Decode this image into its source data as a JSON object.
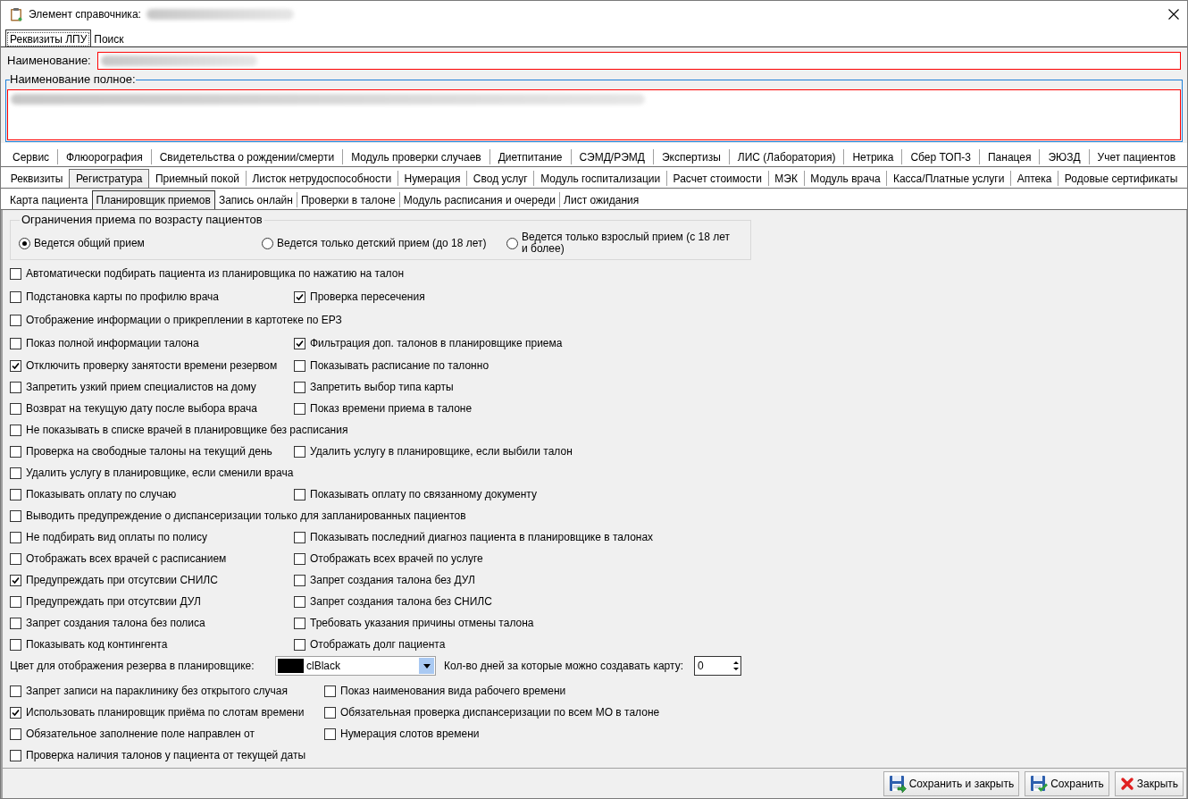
{
  "window": {
    "title": "Элемент справочника:"
  },
  "top_tabs": [
    {
      "label": "Реквизиты ЛПУ",
      "selected": true
    },
    {
      "label": "Поиск",
      "selected": false
    }
  ],
  "name_field": {
    "label": "Наименование:"
  },
  "full_name_group": {
    "label": "Наименование полное:"
  },
  "tab_rows": [
    {
      "tabs": [
        {
          "label": "Сервис",
          "selected": false
        },
        {
          "label": "Флюорография",
          "selected": false
        },
        {
          "label": "Свидетельства о рождении/смерти",
          "selected": false
        },
        {
          "label": "Модуль проверки случаев",
          "selected": false
        },
        {
          "label": "Диетпитание",
          "selected": false
        },
        {
          "label": "СЭМД/РЭМД",
          "selected": false
        },
        {
          "label": "Экспертизы",
          "selected": false
        },
        {
          "label": "ЛИС (Лаборатория)",
          "selected": false
        },
        {
          "label": "Нетрика",
          "selected": false
        },
        {
          "label": "Сбер ТОП-3",
          "selected": false
        },
        {
          "label": "Панацея",
          "selected": false
        },
        {
          "label": "ЭЮЗД",
          "selected": false
        },
        {
          "label": "Учет пациентов",
          "selected": false
        }
      ]
    },
    {
      "tabs": [
        {
          "label": "Реквизиты",
          "selected": false
        },
        {
          "label": "Регистратура",
          "selected": true
        },
        {
          "label": "Приемный покой",
          "selected": false
        },
        {
          "label": "Листок нетрудоспособности",
          "selected": false
        },
        {
          "label": "Нумерация",
          "selected": false
        },
        {
          "label": "Свод услуг",
          "selected": false
        },
        {
          "label": "Модуль госпитализации",
          "selected": false
        },
        {
          "label": "Расчет стоимости",
          "selected": false
        },
        {
          "label": "МЭК",
          "selected": false
        },
        {
          "label": "Модуль врача",
          "selected": false
        },
        {
          "label": "Касса/Платные услуги",
          "selected": false
        },
        {
          "label": "Аптека",
          "selected": false
        },
        {
          "label": "Родовые сертификаты",
          "selected": false
        }
      ]
    }
  ],
  "sub_tabs": [
    {
      "label": "Карта пациента",
      "selected": false
    },
    {
      "label": "Планировщик приемов",
      "selected": true
    },
    {
      "label": "Запись онлайн",
      "selected": false
    },
    {
      "label": "Проверки в талоне",
      "selected": false
    },
    {
      "label": "Модуль расписания и очереди",
      "selected": false
    },
    {
      "label": "Лист ожидания",
      "selected": false
    }
  ],
  "age_limit": {
    "title": "Ограничения приема по возрасту пациентов",
    "options": [
      {
        "label": "Ведется общий прием",
        "selected": true
      },
      {
        "label": "Ведется только детский прием (до 18 лет)",
        "selected": false
      },
      {
        "label": "Ведется только взрослый прием (с 18 лет и более)",
        "selected": false
      }
    ]
  },
  "options": [
    {
      "items": [
        {
          "label": "Автоматически подбирать пациента из планировщика по нажатию на талон",
          "checked": false
        }
      ]
    },
    {
      "items": [
        {
          "label": "Подстановка карты по профилю врача",
          "checked": false
        },
        {
          "label": "Проверка пересечения",
          "checked": true
        }
      ]
    },
    {
      "items": [
        {
          "label": "Отображение информации о прикреплении в картотеке по ЕРЗ",
          "checked": false
        }
      ]
    },
    {
      "items": [
        {
          "label": "Показ полной информации талона",
          "checked": false
        },
        {
          "label": "Фильтрация доп. талонов в планировщике приема",
          "checked": true
        }
      ]
    },
    {
      "items": [
        {
          "label": "Отключить проверку занятости времени резервом",
          "checked": true
        },
        {
          "label": "Показывать расписание по талонно",
          "checked": false
        }
      ]
    },
    {
      "items": [
        {
          "label": "Запретить узкий прием специалистов на дому",
          "checked": false
        },
        {
          "label": "Запретить выбор типа карты",
          "checked": false
        }
      ]
    },
    {
      "items": [
        {
          "label": "Возврат на текущую дату после выбора врача",
          "checked": false
        },
        {
          "label": "Показ времени приема в талоне",
          "checked": false
        }
      ]
    },
    {
      "items": [
        {
          "label": "Не показывать в списке врачей в планировщике без расписания",
          "checked": false
        }
      ]
    },
    {
      "items": [
        {
          "label": "Проверка на свободные талоны на текущий день",
          "checked": false
        },
        {
          "label": "Удалить услугу в планировщике, если выбили талон",
          "checked": false
        }
      ]
    },
    {
      "items": [
        {
          "label": "Удалить услугу в планировщике, если сменили врача",
          "checked": false
        }
      ]
    },
    {
      "items": [
        {
          "label": "Показывать оплату по случаю",
          "checked": false
        },
        {
          "label": "Показывать оплату по связанному документу",
          "checked": false
        }
      ]
    },
    {
      "items": [
        {
          "label": "Выводить предупреждение о диспансеризации только для запланированных пациентов",
          "checked": false
        }
      ]
    },
    {
      "items": [
        {
          "label": "Не подбирать вид оплаты по полису",
          "checked": false
        },
        {
          "label": "Показывать последний диагноз пациента в планировщике в талонах",
          "checked": false
        }
      ]
    },
    {
      "items": [
        {
          "label": "Отображать всех врачей с расписанием",
          "checked": false
        },
        {
          "label": "Отображать всех врачей по услуге",
          "checked": false
        }
      ]
    },
    {
      "items": [
        {
          "label": "Предупреждать при отсутсвии СНИЛС",
          "checked": true
        },
        {
          "label": "Запрет создания талона без ДУЛ",
          "checked": false
        }
      ]
    },
    {
      "items": [
        {
          "label": "Предупреждать при отсутсвии ДУЛ",
          "checked": false
        },
        {
          "label": "Запрет создания талона без СНИЛС",
          "checked": false
        }
      ]
    },
    {
      "items": [
        {
          "label": "Запрет создания талона без полиса",
          "checked": false
        },
        {
          "label": "Требовать указания причины отмены талона",
          "checked": false
        }
      ]
    },
    {
      "items": [
        {
          "label": "Показывать код контингента",
          "checked": false
        },
        {
          "label": "Отображать долг пациента",
          "checked": false
        }
      ]
    }
  ],
  "reserve_color": {
    "label": "Цвет для отображения резерва в планировщике:",
    "value": "clBlack",
    "color": "#000000"
  },
  "card_days": {
    "label": "Кол-во дней за которые можно создавать карту:",
    "value": "0"
  },
  "options_2": [
    {
      "items": [
        {
          "label": "Запрет записи на параклинику без открытого случая",
          "checked": false
        },
        {
          "label": "Показ наименования вида рабочего времени",
          "checked": false
        }
      ]
    },
    {
      "items": [
        {
          "label": "Использовать планировщик приёма по слотам времени",
          "checked": true
        },
        {
          "label": "Обязательная проверка диспансеризации по всем МО в талоне",
          "checked": false
        }
      ]
    },
    {
      "items": [
        {
          "label": "Обязательное заполнение поле направлен от",
          "checked": false
        },
        {
          "label": "Нумерация слотов времени",
          "checked": false
        }
      ]
    },
    {
      "items": [
        {
          "label": "Проверка наличия талонов у пациента от текущей даты",
          "checked": false
        }
      ]
    }
  ],
  "buttons": [
    {
      "label": "Сохранить и закрыть",
      "kind": "save_close"
    },
    {
      "label": "Сохранить",
      "kind": "save"
    },
    {
      "label": "Закрыть",
      "kind": "close"
    }
  ]
}
